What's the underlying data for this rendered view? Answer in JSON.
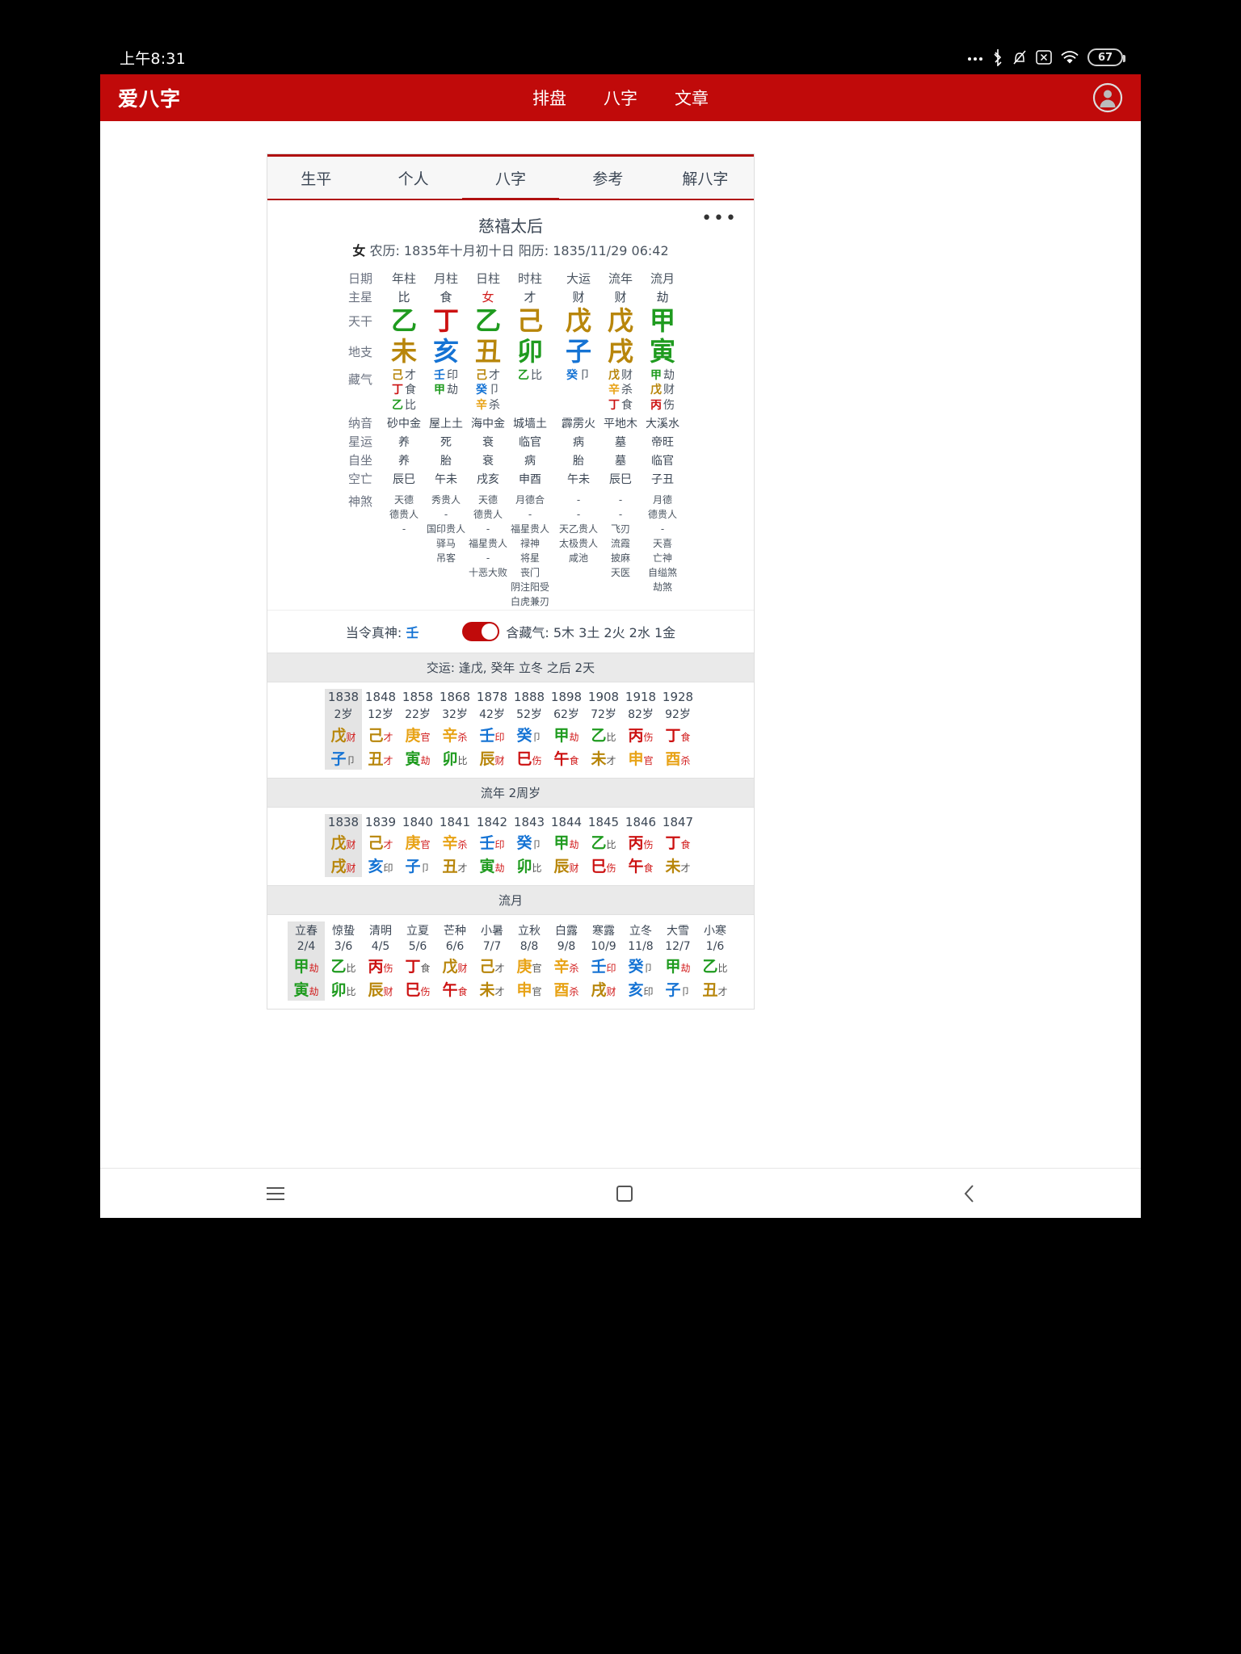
{
  "status_bar": {
    "time": "上午8:31",
    "battery_level": "67",
    "icons": [
      "more-dots-icon",
      "bluetooth-icon",
      "bell-muted-icon",
      "x-box-icon",
      "wifi-icon",
      "battery-icon"
    ]
  },
  "header": {
    "logo": "爱八字",
    "nav": [
      {
        "label": "排盘"
      },
      {
        "label": "八字"
      },
      {
        "label": "文章"
      }
    ],
    "avatar_icon": "account-circle-icon"
  },
  "tabs": [
    {
      "label": "生平",
      "active": false
    },
    {
      "label": "个人",
      "active": false
    },
    {
      "label": "八字",
      "active": true
    },
    {
      "label": "参考",
      "active": false
    },
    {
      "label": "解八字",
      "active": false
    }
  ],
  "chart": {
    "person_name": "慈禧太后",
    "more_icon": "more-horizontal-icon",
    "gender": "女",
    "birth_info": "农历: 1835年十月初十日 阳历: 1835/11/29 06:42",
    "column_headers": [
      "日期",
      "年柱",
      "月柱",
      "日柱",
      "时柱",
      "大运",
      "流年",
      "流月"
    ],
    "rows": {
      "zhuxing": {
        "label": "主星",
        "values": [
          "比",
          "食",
          "女",
          "才",
          "财",
          "财",
          "劫"
        ],
        "highlight_index": 2
      },
      "tiangan": {
        "label": "天干",
        "values": [
          {
            "char": "乙",
            "element": "wood"
          },
          {
            "char": "丁",
            "element": "fire"
          },
          {
            "char": "乙",
            "element": "wood"
          },
          {
            "char": "己",
            "element": "earth"
          },
          {
            "char": "戊",
            "element": "earth"
          },
          {
            "char": "戊",
            "element": "earth"
          },
          {
            "char": "甲",
            "element": "wood"
          }
        ]
      },
      "dizhi": {
        "label": "地支",
        "values": [
          {
            "char": "未",
            "element": "earth"
          },
          {
            "char": "亥",
            "element": "water"
          },
          {
            "char": "丑",
            "element": "earth"
          },
          {
            "char": "卯",
            "element": "wood"
          },
          {
            "char": "子",
            "element": "water"
          },
          {
            "char": "戌",
            "element": "earth"
          },
          {
            "char": "寅",
            "element": "wood"
          }
        ]
      },
      "cangqi": {
        "label": "藏气",
        "columns": [
          [
            {
              "g": "己",
              "e": "earth",
              "s": "才"
            },
            {
              "g": "丁",
              "e": "fire",
              "s": "食"
            },
            {
              "g": "乙",
              "e": "wood",
              "s": "比"
            }
          ],
          [
            {
              "g": "壬",
              "e": "water",
              "s": "印"
            },
            {
              "g": "甲",
              "e": "wood",
              "s": "劫"
            }
          ],
          [
            {
              "g": "己",
              "e": "earth",
              "s": "才"
            },
            {
              "g": "癸",
              "e": "water",
              "s": "卩"
            },
            {
              "g": "辛",
              "e": "metal",
              "s": "杀"
            }
          ],
          [
            {
              "g": "乙",
              "e": "wood",
              "s": "比"
            }
          ],
          [
            {
              "g": "癸",
              "e": "water",
              "s": "卩"
            }
          ],
          [
            {
              "g": "戊",
              "e": "earth",
              "s": "财"
            },
            {
              "g": "辛",
              "e": "metal",
              "s": "杀"
            },
            {
              "g": "丁",
              "e": "fire",
              "s": "食"
            }
          ],
          [
            {
              "g": "甲",
              "e": "wood",
              "s": "劫"
            },
            {
              "g": "戊",
              "e": "earth",
              "s": "财"
            },
            {
              "g": "丙",
              "e": "fire",
              "s": "伤"
            }
          ]
        ]
      },
      "nayin": {
        "label": "纳音",
        "values": [
          "砂中金",
          "屋上土",
          "海中金",
          "城墙土",
          "霹雳火",
          "平地木",
          "大溪水"
        ]
      },
      "xingyun": {
        "label": "星运",
        "values": [
          "养",
          "死",
          "衰",
          "临官",
          "病",
          "墓",
          "帝旺"
        ]
      },
      "zizuo": {
        "label": "自坐",
        "values": [
          "养",
          "胎",
          "衰",
          "病",
          "胎",
          "墓",
          "临官"
        ]
      },
      "kongwang": {
        "label": "空亡",
        "values": [
          "辰巳",
          "午未",
          "戌亥",
          "申酉",
          "午未",
          "辰巳",
          "子丑"
        ]
      },
      "shensha": {
        "label": "神煞",
        "columns": [
          [
            "天德",
            "德贵人",
            "-"
          ],
          [
            "秀贵人",
            "-",
            "国印贵人",
            "驿马",
            "吊客"
          ],
          [
            "天德",
            "德贵人",
            "-",
            "福星贵人",
            "-",
            "十恶大败"
          ],
          [
            "月德合",
            "-",
            "福星贵人",
            "禄神",
            "将星",
            "丧门",
            "阴注阳受",
            "白虎兼刃"
          ],
          [
            "-",
            "-",
            "天乙贵人",
            "太极贵人",
            "咸池"
          ],
          [
            "-",
            "-",
            "飞刃",
            "流霞",
            "披麻",
            "天医"
          ],
          [
            "月德",
            "德贵人",
            "-",
            "天喜",
            "亡神",
            "自缢煞",
            "劫煞"
          ]
        ]
      }
    },
    "footer": {
      "dangling_label": "当令真神:",
      "dangling_value": "壬",
      "toggle_on": true,
      "hidden_qi_label": "含藏气:",
      "hidden_qi_value": "5木 3土 2火 2水 1金"
    }
  },
  "dayun": {
    "band": "交运: 逢戊, 癸年 立冬 之后 2天",
    "years": [
      "1838",
      "1848",
      "1858",
      "1868",
      "1878",
      "1888",
      "1898",
      "1908",
      "1918",
      "1928"
    ],
    "ages": [
      "2岁",
      "12岁",
      "22岁",
      "32岁",
      "42岁",
      "52岁",
      "62岁",
      "72岁",
      "82岁",
      "92岁"
    ],
    "gan": [
      {
        "c": "戊",
        "e": "earth",
        "s": "财",
        "sc": "red"
      },
      {
        "c": "己",
        "e": "earth",
        "s": "才",
        "sc": "red"
      },
      {
        "c": "庚",
        "e": "metal",
        "s": "官",
        "sc": "red"
      },
      {
        "c": "辛",
        "e": "metal",
        "s": "杀",
        "sc": "red"
      },
      {
        "c": "壬",
        "e": "water",
        "s": "印",
        "sc": "red"
      },
      {
        "c": "癸",
        "e": "water",
        "s": "卩",
        "sc": "gray"
      },
      {
        "c": "甲",
        "e": "wood",
        "s": "劫",
        "sc": "red"
      },
      {
        "c": "乙",
        "e": "wood",
        "s": "比",
        "sc": "gray"
      },
      {
        "c": "丙",
        "e": "fire",
        "s": "伤",
        "sc": "red"
      },
      {
        "c": "丁",
        "e": "fire",
        "s": "食",
        "sc": "red"
      }
    ],
    "zhi": [
      {
        "c": "子",
        "e": "water",
        "s": "卩",
        "sc": "gray"
      },
      {
        "c": "丑",
        "e": "earth",
        "s": "才",
        "sc": "red"
      },
      {
        "c": "寅",
        "e": "wood",
        "s": "劫",
        "sc": "red"
      },
      {
        "c": "卯",
        "e": "wood",
        "s": "比",
        "sc": "gray"
      },
      {
        "c": "辰",
        "e": "earth",
        "s": "财",
        "sc": "red"
      },
      {
        "c": "巳",
        "e": "fire",
        "s": "伤",
        "sc": "red"
      },
      {
        "c": "午",
        "e": "fire",
        "s": "食",
        "sc": "red"
      },
      {
        "c": "未",
        "e": "earth",
        "s": "才",
        "sc": "gray"
      },
      {
        "c": "申",
        "e": "metal",
        "s": "官",
        "sc": "red"
      },
      {
        "c": "酉",
        "e": "metal",
        "s": "杀",
        "sc": "red"
      }
    ]
  },
  "liunian": {
    "band": "流年 2周岁",
    "years": [
      "1838",
      "1839",
      "1840",
      "1841",
      "1842",
      "1843",
      "1844",
      "1845",
      "1846",
      "1847"
    ],
    "gan": [
      {
        "c": "戊",
        "e": "earth",
        "s": "财",
        "sc": "red"
      },
      {
        "c": "己",
        "e": "earth",
        "s": "才",
        "sc": "red"
      },
      {
        "c": "庚",
        "e": "metal",
        "s": "官",
        "sc": "red"
      },
      {
        "c": "辛",
        "e": "metal",
        "s": "杀",
        "sc": "red"
      },
      {
        "c": "壬",
        "e": "water",
        "s": "印",
        "sc": "red"
      },
      {
        "c": "癸",
        "e": "water",
        "s": "卩",
        "sc": "gray"
      },
      {
        "c": "甲",
        "e": "wood",
        "s": "劫",
        "sc": "red"
      },
      {
        "c": "乙",
        "e": "wood",
        "s": "比",
        "sc": "gray"
      },
      {
        "c": "丙",
        "e": "fire",
        "s": "伤",
        "sc": "red"
      },
      {
        "c": "丁",
        "e": "fire",
        "s": "食",
        "sc": "red"
      }
    ],
    "zhi": [
      {
        "c": "戌",
        "e": "earth",
        "s": "财",
        "sc": "red"
      },
      {
        "c": "亥",
        "e": "water",
        "s": "印",
        "sc": "gray"
      },
      {
        "c": "子",
        "e": "water",
        "s": "卩",
        "sc": "gray"
      },
      {
        "c": "丑",
        "e": "earth",
        "s": "才",
        "sc": "gray"
      },
      {
        "c": "寅",
        "e": "wood",
        "s": "劫",
        "sc": "red"
      },
      {
        "c": "卯",
        "e": "wood",
        "s": "比",
        "sc": "gray"
      },
      {
        "c": "辰",
        "e": "earth",
        "s": "财",
        "sc": "red"
      },
      {
        "c": "巳",
        "e": "fire",
        "s": "伤",
        "sc": "red"
      },
      {
        "c": "午",
        "e": "fire",
        "s": "食",
        "sc": "red"
      },
      {
        "c": "未",
        "e": "earth",
        "s": "才",
        "sc": "gray"
      }
    ]
  },
  "liuyue": {
    "band": "流月",
    "terms": [
      "立春",
      "惊蛰",
      "清明",
      "立夏",
      "芒种",
      "小暑",
      "立秋",
      "白露",
      "寒露",
      "立冬",
      "大雪",
      "小寒"
    ],
    "dates": [
      "2/4",
      "3/6",
      "4/5",
      "5/6",
      "6/6",
      "7/7",
      "8/8",
      "9/8",
      "10/9",
      "11/8",
      "12/7",
      "1/6"
    ],
    "gan": [
      {
        "c": "甲",
        "e": "wood",
        "s": "劫",
        "sc": "red"
      },
      {
        "c": "乙",
        "e": "wood",
        "s": "比",
        "sc": "gray"
      },
      {
        "c": "丙",
        "e": "fire",
        "s": "伤",
        "sc": "red"
      },
      {
        "c": "丁",
        "e": "fire",
        "s": "食",
        "sc": "gray"
      },
      {
        "c": "戊",
        "e": "earth",
        "s": "财",
        "sc": "red"
      },
      {
        "c": "己",
        "e": "earth",
        "s": "才",
        "sc": "gray"
      },
      {
        "c": "庚",
        "e": "metal",
        "s": "官",
        "sc": "gray"
      },
      {
        "c": "辛",
        "e": "metal",
        "s": "杀",
        "sc": "red"
      },
      {
        "c": "壬",
        "e": "water",
        "s": "印",
        "sc": "red"
      },
      {
        "c": "癸",
        "e": "water",
        "s": "卩",
        "sc": "gray"
      },
      {
        "c": "甲",
        "e": "wood",
        "s": "劫",
        "sc": "red"
      },
      {
        "c": "乙",
        "e": "wood",
        "s": "比",
        "sc": "gray"
      }
    ],
    "zhi": [
      {
        "c": "寅",
        "e": "wood",
        "s": "劫",
        "sc": "red"
      },
      {
        "c": "卯",
        "e": "wood",
        "s": "比",
        "sc": "gray"
      },
      {
        "c": "辰",
        "e": "earth",
        "s": "财",
        "sc": "red"
      },
      {
        "c": "巳",
        "e": "fire",
        "s": "伤",
        "sc": "red"
      },
      {
        "c": "午",
        "e": "fire",
        "s": "食",
        "sc": "red"
      },
      {
        "c": "未",
        "e": "earth",
        "s": "才",
        "sc": "gray"
      },
      {
        "c": "申",
        "e": "metal",
        "s": "官",
        "sc": "gray"
      },
      {
        "c": "酉",
        "e": "metal",
        "s": "杀",
        "sc": "red"
      },
      {
        "c": "戌",
        "e": "earth",
        "s": "财",
        "sc": "red"
      },
      {
        "c": "亥",
        "e": "water",
        "s": "印",
        "sc": "gray"
      },
      {
        "c": "子",
        "e": "water",
        "s": "卩",
        "sc": "gray"
      },
      {
        "c": "丑",
        "e": "earth",
        "s": "才",
        "sc": "gray"
      }
    ]
  },
  "navbar": {
    "items": [
      "menu-icon",
      "home-square-icon",
      "back-chevron-icon"
    ]
  }
}
